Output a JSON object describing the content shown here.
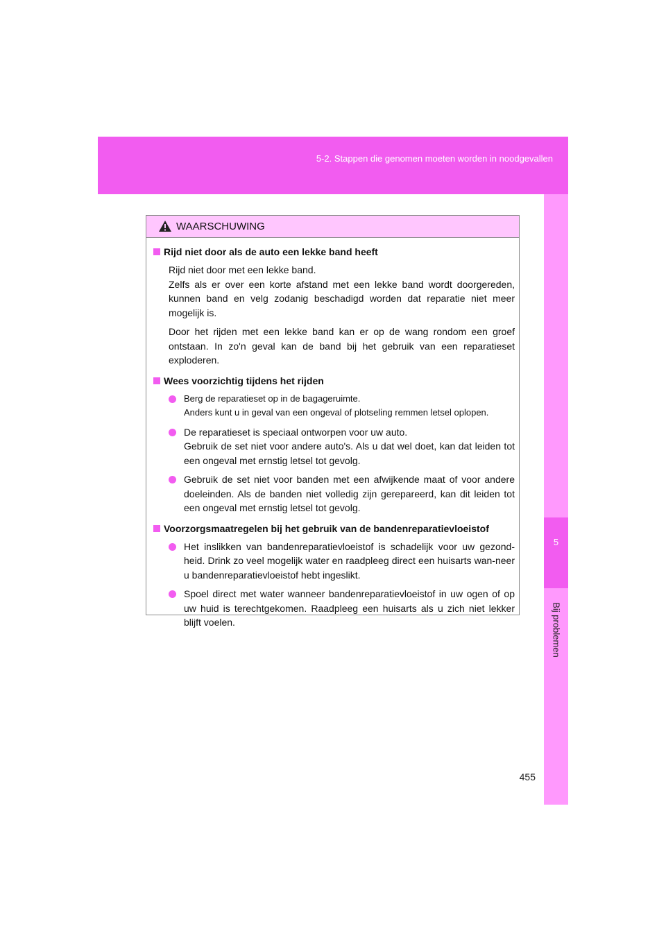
{
  "header": {
    "section": "5-2. Stappen die genomen moeten worden in noodgevallen"
  },
  "side_tab": {
    "chapter_number": "5",
    "chapter_title": "Bij problemen"
  },
  "page_number": "455",
  "warning": {
    "title": "WAARSCHUWING",
    "sections": [
      {
        "title": "Rijd niet door als de auto een lekke band heeft",
        "paragraphs": [
          "Rijd niet door met een lekke band.",
          "Zelfs als er over een korte afstand met een lekke band wordt doorgereden, kunnen band en velg zodanig beschadigd worden dat reparatie niet meer mogelijk is.",
          "Door het rijden met een lekke band kan er op de wang rondom een groef ontstaan. In zo'n geval kan de band bij het gebruik van een reparatieset exploderen."
        ]
      },
      {
        "title": "Wees voorzichtig tijdens het rijden",
        "bullets": [
          [
            "Berg de reparatieset op in de bagageruimte.",
            "Anders kunt u in geval van een ongeval of plotseling remmen letsel oplopen."
          ],
          [
            "De reparatieset is speciaal ontworpen voor uw auto.",
            "Gebruik de set niet voor andere auto's. Als u dat wel doet, kan dat leiden tot een ongeval met ernstig letsel tot gevolg."
          ],
          [
            "Gebruik de set niet voor banden met een afwijkende maat of voor andere doeleinden. Als de banden niet volledig zijn gerepareerd, kan dit leiden tot een ongeval met ernstig letsel tot gevolg."
          ]
        ]
      },
      {
        "title": "Voorzorgsmaatregelen bij het gebruik van de bandenreparatievloeistof",
        "bullets": [
          [
            "Het inslikken van bandenreparatievloeistof is schadelijk voor uw gezond-heid. Drink zo veel mogelijk water en raadpleeg direct een huisarts wan-neer u bandenreparatievloeistof hebt ingeslikt."
          ],
          [
            "Spoel direct met water wanneer bandenreparatievloeistof in uw ogen of op uw huid is terechtgekomen. Raadpleeg een huisarts als u zich niet lekker blijft voelen."
          ]
        ]
      }
    ]
  }
}
